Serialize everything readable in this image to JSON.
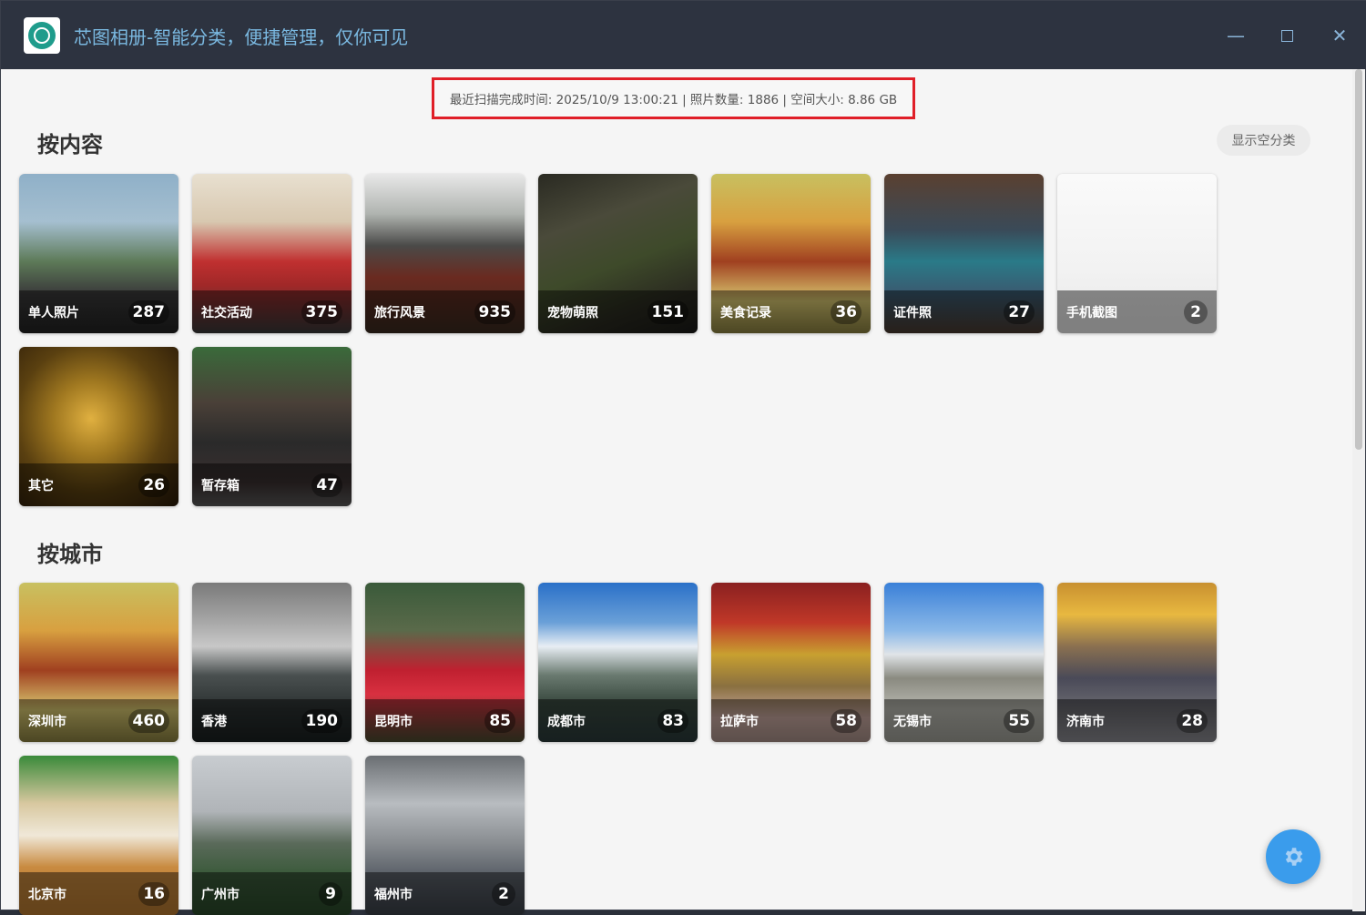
{
  "app": {
    "title": "芯图相册-智能分类，便捷管理，仅你可见"
  },
  "window_controls": {
    "minimize": "—",
    "close": "✕"
  },
  "scan_info": "最近扫描完成时间: 2025/10/9 13:00:21 | 照片数量: 1886 | 空间大小: 8.86 GB",
  "show_empty_label": "显示空分类",
  "sections": {
    "content": {
      "title": "按内容",
      "items": [
        {
          "label": "单人照片",
          "count": "287"
        },
        {
          "label": "社交活动",
          "count": "375"
        },
        {
          "label": "旅行风景",
          "count": "935"
        },
        {
          "label": "宠物萌照",
          "count": "151"
        },
        {
          "label": "美食记录",
          "count": "36"
        },
        {
          "label": "证件照",
          "count": "27"
        },
        {
          "label": "手机截图",
          "count": "2"
        },
        {
          "label": "其它",
          "count": "26"
        },
        {
          "label": "暂存箱",
          "count": "47"
        }
      ]
    },
    "city": {
      "title": "按城市",
      "items": [
        {
          "label": "深圳市",
          "count": "460"
        },
        {
          "label": "香港",
          "count": "190"
        },
        {
          "label": "昆明市",
          "count": "85"
        },
        {
          "label": "成都市",
          "count": "83"
        },
        {
          "label": "拉萨市",
          "count": "58"
        },
        {
          "label": "无锡市",
          "count": "55"
        },
        {
          "label": "济南市",
          "count": "28"
        },
        {
          "label": "北京市",
          "count": "16"
        },
        {
          "label": "广州市",
          "count": "9"
        },
        {
          "label": "福州市",
          "count": "2"
        }
      ]
    }
  },
  "colors": {
    "titlebar": "#2d3340",
    "title_text": "#7ab8e0",
    "highlight_border": "#e01f28",
    "fab": "#3a9cec"
  }
}
